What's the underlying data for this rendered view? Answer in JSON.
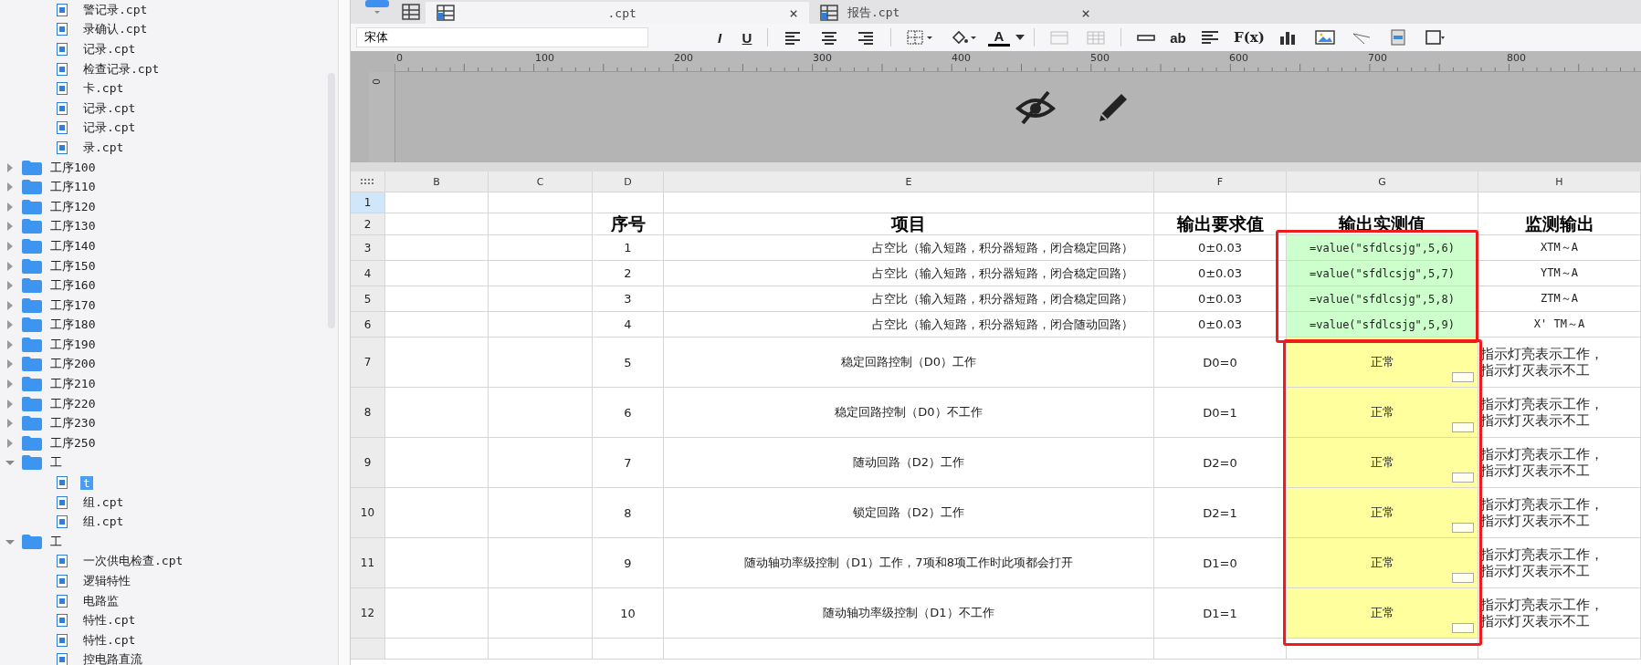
{
  "sidebar": {
    "items": [
      {
        "kind": "folder",
        "expanded": true,
        "children": [
          {
            "kind": "file",
            "label": "警记录.cpt",
            "selected": false
          },
          {
            "kind": "file",
            "label": "录确认.cpt",
            "selected": false
          },
          {
            "kind": "file",
            "label": "记录.cpt",
            "selected": false
          },
          {
            "kind": "file",
            "label": "检查记录.cpt",
            "selected": false
          },
          {
            "kind": "file",
            "label": "卡.cpt",
            "selected": false
          },
          {
            "kind": "file",
            "label": "记录.cpt",
            "selected": false
          },
          {
            "kind": "file",
            "label": "记录.cpt",
            "selected": false
          },
          {
            "kind": "file",
            "label": "录.cpt",
            "selected": false
          }
        ]
      },
      {
        "kind": "folder",
        "label": "工序100",
        "expanded": false
      },
      {
        "kind": "folder",
        "label": "工序110",
        "expanded": false
      },
      {
        "kind": "folder",
        "label": "工序120",
        "expanded": false
      },
      {
        "kind": "folder",
        "label": "工序130",
        "expanded": false
      },
      {
        "kind": "folder",
        "label": "工序140",
        "expanded": false
      },
      {
        "kind": "folder",
        "label": "工序150",
        "expanded": false
      },
      {
        "kind": "folder",
        "label": "工序160",
        "expanded": false
      },
      {
        "kind": "folder",
        "label": "工序170",
        "expanded": false
      },
      {
        "kind": "folder",
        "label": "工序180",
        "expanded": false
      },
      {
        "kind": "folder",
        "label": "工序190",
        "expanded": false
      },
      {
        "kind": "folder",
        "label": "工序200",
        "expanded": false
      },
      {
        "kind": "folder",
        "label": "工序210",
        "expanded": false
      },
      {
        "kind": "folder",
        "label": "工序220",
        "expanded": false
      },
      {
        "kind": "folder",
        "label": "工序230",
        "expanded": false
      },
      {
        "kind": "folder",
        "label": "工序250",
        "expanded": false
      },
      {
        "kind": "folder",
        "label": "工",
        "expanded": true,
        "children": [
          {
            "kind": "file",
            "label": "t",
            "selected": true
          },
          {
            "kind": "file",
            "label": "组.cpt",
            "selected": false
          },
          {
            "kind": "file",
            "label": "组.cpt",
            "selected": false
          }
        ]
      },
      {
        "kind": "folder",
        "label": "工",
        "expanded": true,
        "children": [
          {
            "kind": "file",
            "label": "一次供电检查.cpt",
            "selected": false
          },
          {
            "kind": "file",
            "label": "逻辑特性",
            "selected": false
          },
          {
            "kind": "file",
            "label": "电路监",
            "selected": false
          },
          {
            "kind": "file",
            "label": "特性.cpt",
            "selected": false
          },
          {
            "kind": "file",
            "label": "特性.cpt",
            "selected": false
          },
          {
            "kind": "file",
            "label": "控电路直流",
            "selected": false
          }
        ]
      }
    ]
  },
  "tabs": [
    {
      "label": ".cpt",
      "close": "×",
      "selected": true
    },
    {
      "label": "报告.cpt",
      "close": "×",
      "selected": false
    }
  ],
  "toolbar": {
    "font": "宋体",
    "items": [
      {
        "kind": "italic",
        "label": "I"
      },
      {
        "kind": "underline",
        "label": "U"
      },
      {
        "kind": "sep"
      },
      {
        "kind": "align-left"
      },
      {
        "kind": "align-center"
      },
      {
        "kind": "align-right"
      },
      {
        "kind": "sep"
      },
      {
        "kind": "border"
      },
      {
        "kind": "fill"
      },
      {
        "kind": "font-color",
        "label": "A"
      },
      {
        "kind": "sep"
      },
      {
        "kind": "merge"
      },
      {
        "kind": "unmerge"
      },
      {
        "kind": "sep"
      },
      {
        "kind": "textbox"
      },
      {
        "kind": "text",
        "label": "ab"
      },
      {
        "kind": "paragraph"
      },
      {
        "kind": "formula",
        "label": "F(x)"
      },
      {
        "kind": "chart"
      },
      {
        "kind": "image"
      },
      {
        "kind": "slash"
      },
      {
        "kind": "subreport"
      },
      {
        "kind": "frame"
      }
    ]
  },
  "ruler": {
    "marks": [
      "0",
      "100",
      "200",
      "300",
      "400",
      "500",
      "600",
      "700",
      "800"
    ],
    "side": "0"
  },
  "sheet": {
    "columns": [
      "B",
      "C",
      "D",
      "E",
      "F",
      "G",
      "H"
    ],
    "rows": [
      {
        "number": "1",
        "selected": true,
        "kind": "blank"
      },
      {
        "number": "2",
        "selected": false,
        "kind": "header",
        "seq": "序号",
        "item": "项目",
        "requirement": "输出要求值",
        "measured": "输出实测值",
        "monitor": [
          "监测输出"
        ]
      },
      {
        "number": "3",
        "selected": false,
        "kind": "formula",
        "seq": "1",
        "item": "占空比（输入短路，积分器短路，闭合稳定回路）",
        "requirement": "0±0.03",
        "measured": "=value(\"sfdlcsjg\",5,6)",
        "monitor": [
          "XTM～A"
        ]
      },
      {
        "number": "4",
        "selected": false,
        "kind": "formula",
        "seq": "2",
        "item": "占空比（输入短路，积分器短路，闭合稳定回路）",
        "requirement": "0±0.03",
        "measured": "=value(\"sfdlcsjg\",5,7)",
        "monitor": [
          "YTM～A"
        ]
      },
      {
        "number": "5",
        "selected": false,
        "kind": "formula",
        "seq": "3",
        "item": "占空比（输入短路，积分器短路，闭合稳定回路）",
        "requirement": "0±0.03",
        "measured": "=value(\"sfdlcsjg\",5,8)",
        "monitor": [
          "ZTM～A"
        ]
      },
      {
        "number": "6",
        "selected": false,
        "kind": "formula",
        "seq": "4",
        "item": "占空比（输入短路，积分器短路，闭合随动回路）",
        "requirement": "0±0.03",
        "measured": "=value(\"sfdlcsjg\",5,9)",
        "monitor": [
          "X' TM～A"
        ]
      },
      {
        "number": "7",
        "selected": false,
        "kind": "result",
        "seq": "5",
        "item": "稳定回路控制（D0）工作",
        "requirement": "D0=0",
        "measured": "正常",
        "monitor": [
          "指示灯亮表示工作，",
          "指示灯灭表示不工"
        ]
      },
      {
        "number": "8",
        "selected": false,
        "kind": "result",
        "seq": "6",
        "item": "稳定回路控制（D0）不工作",
        "requirement": "D0=1",
        "measured": "正常",
        "monitor": [
          "指示灯亮表示工作，",
          "指示灯灭表示不工"
        ]
      },
      {
        "number": "9",
        "selected": false,
        "kind": "result",
        "seq": "7",
        "item": "随动回路（D2）工作",
        "requirement": "D2=0",
        "measured": "正常",
        "monitor": [
          "指示灯亮表示工作，",
          "指示灯灭表示不工"
        ]
      },
      {
        "number": "10",
        "selected": false,
        "kind": "result",
        "seq": "8",
        "item": "锁定回路（D2）工作",
        "requirement": "D2=1",
        "measured": "正常",
        "monitor": [
          "指示灯亮表示工作，",
          "指示灯灭表示不工"
        ]
      },
      {
        "number": "11",
        "selected": false,
        "kind": "result",
        "seq": "9",
        "item": "随动轴功率级控制（D1）工作，7项和8项工作时此项都会打开",
        "requirement": "D1=0",
        "measured": "正常",
        "monitor": [
          "指示灯亮表示工作，",
          "指示灯灭表示不工"
        ]
      },
      {
        "number": "12",
        "selected": false,
        "kind": "result",
        "seq": "10",
        "item": "随动轴功率级控制（D1）不工作",
        "requirement": "D1=1",
        "measured": "正常",
        "monitor": [
          "指示灯亮表示工作，",
          "指示灯灭表示不工"
        ]
      },
      {
        "selected": false,
        "kind": "blank"
      }
    ]
  }
}
